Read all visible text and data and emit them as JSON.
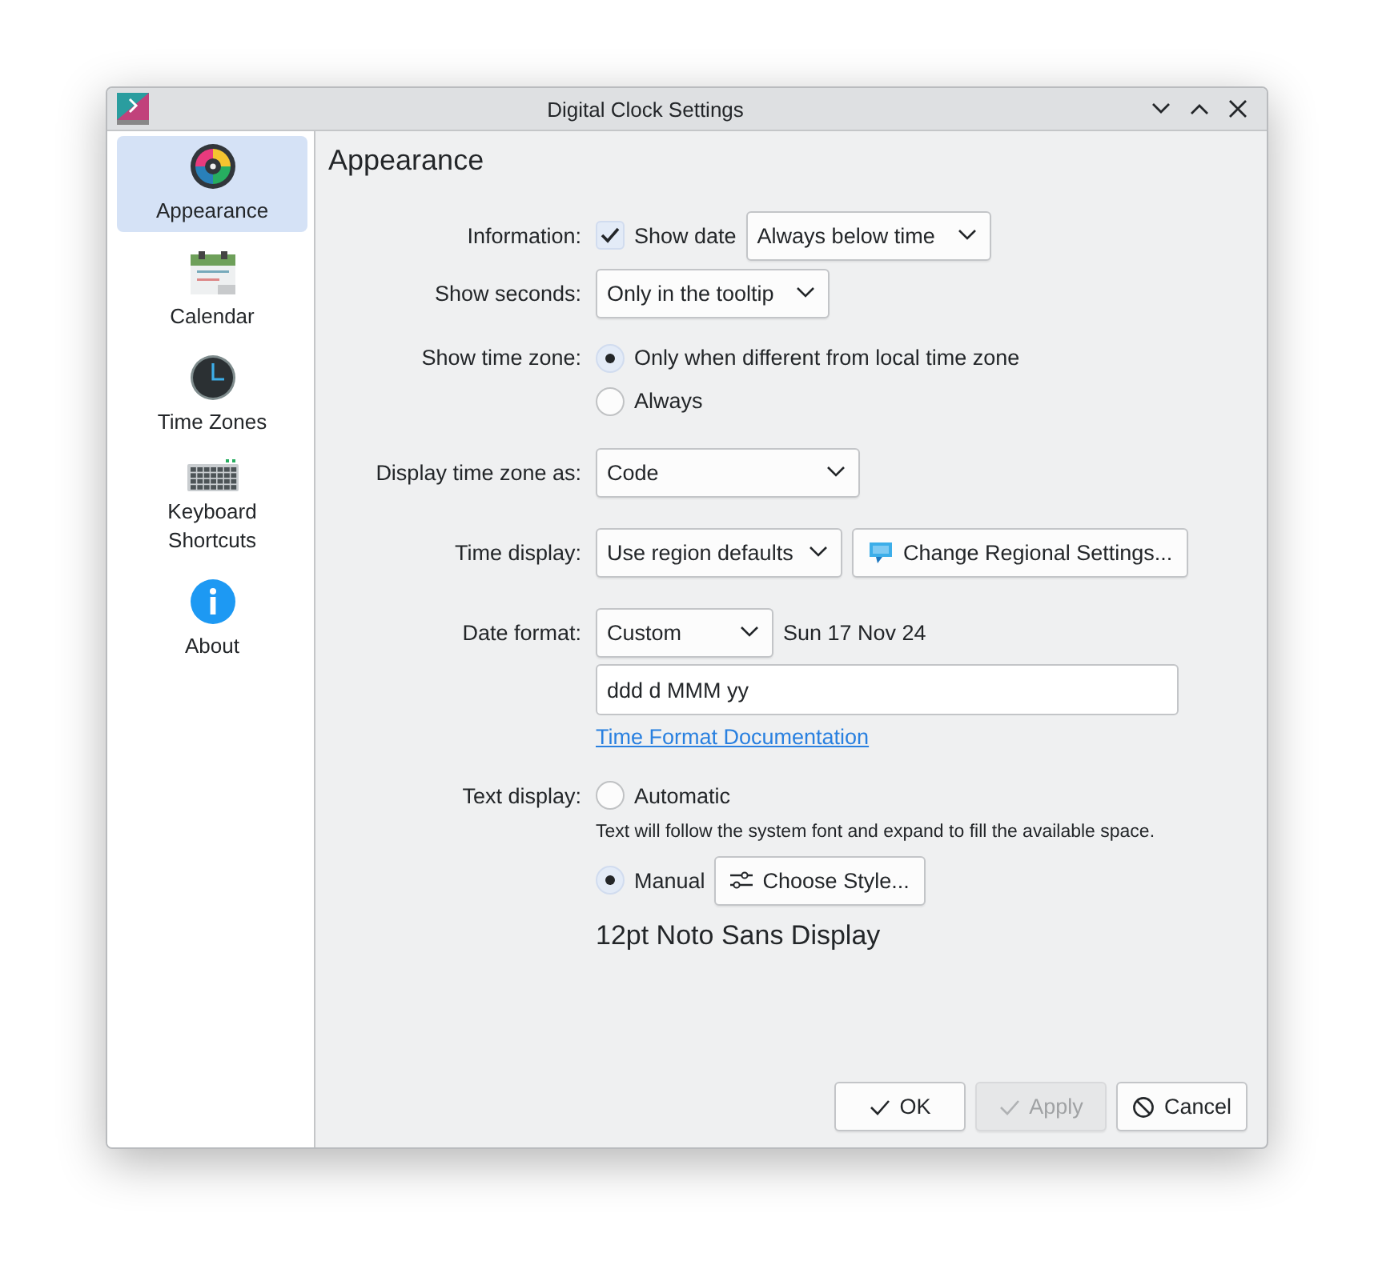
{
  "window": {
    "title": "Digital Clock Settings"
  },
  "sidebar": {
    "items": [
      {
        "label": "Appearance",
        "selected": true
      },
      {
        "label": "Calendar",
        "selected": false
      },
      {
        "label": "Time Zones",
        "selected": false
      },
      {
        "label": "Keyboard Shortcuts",
        "selected": false
      },
      {
        "label": "About",
        "selected": false
      }
    ]
  },
  "page_title": "Appearance",
  "information": {
    "label": "Information:",
    "checkbox": {
      "label": "Show date",
      "checked": true
    },
    "dropdown": "Always below time"
  },
  "show_seconds": {
    "label": "Show seconds:",
    "dropdown": "Only in the tooltip"
  },
  "show_time_zone": {
    "label": "Show time zone:",
    "options": [
      {
        "label": "Only when different from local time zone",
        "selected": true
      },
      {
        "label": "Always",
        "selected": false
      }
    ]
  },
  "display_time_zone_as": {
    "label": "Display time zone as:",
    "dropdown": "Code"
  },
  "time_display": {
    "label": "Time display:",
    "dropdown": "Use region defaults",
    "button": "Change Regional Settings..."
  },
  "date_format": {
    "label": "Date format:",
    "dropdown": "Custom",
    "preview": "Sun 17 Nov 24",
    "value": "ddd d MMM yy",
    "link": "Time Format Documentation"
  },
  "text_display": {
    "label": "Text display:",
    "automatic": {
      "label": "Automatic",
      "selected": false,
      "hint": "Text will follow the system font and expand to fill the available space."
    },
    "manual": {
      "label": "Manual",
      "selected": true,
      "button": "Choose Style..."
    },
    "font": "12pt Noto Sans Display"
  },
  "buttons": [
    {
      "label": "OK",
      "kind": "ok",
      "disabled": false
    },
    {
      "label": "Apply",
      "kind": "ok",
      "disabled": true
    },
    {
      "label": "Cancel",
      "kind": "cancel",
      "disabled": false
    }
  ]
}
